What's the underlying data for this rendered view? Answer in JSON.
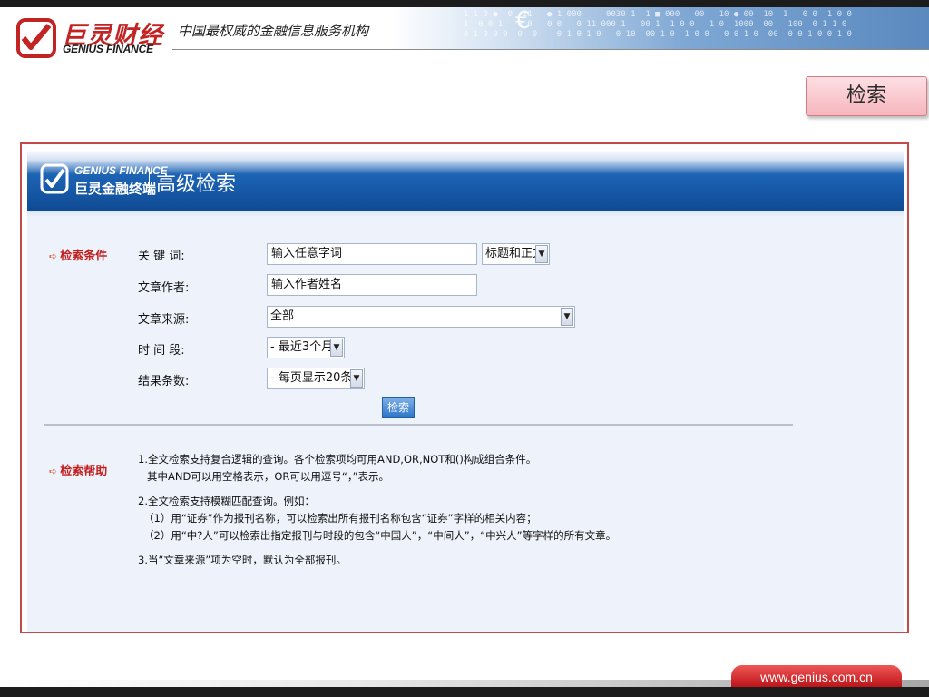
{
  "header": {
    "brand_cn": "巨灵财经",
    "brand_en": "GENIUS FINANCE",
    "slogan": "中国最权威的金融信息服务机构"
  },
  "top_search_button": "检索",
  "panel": {
    "brand_en": "GENIUS FINANCE",
    "brand_cn": "巨灵金融终端",
    "title": "高级检索"
  },
  "form": {
    "section_label": "检索条件",
    "keyword": {
      "label": "关 键 词:",
      "value": "输入任意字词",
      "scope": "标题和正文"
    },
    "author": {
      "label": "文章作者:",
      "value": "输入作者姓名"
    },
    "source": {
      "label": "文章来源:",
      "value": "全部"
    },
    "period": {
      "label": "时 间 段:",
      "value": "- 最近3个月 -"
    },
    "result_count": {
      "label": "结果条数:",
      "value": "- 每页显示20条 -"
    },
    "submit_label": "检索"
  },
  "help": {
    "section_label": "检索帮助",
    "lines": [
      "1.全文检索支持复合逻辑的查询。各个检索项均可用AND,OR,NOT和()构成组合条件。",
      "其中AND可以用空格表示，OR可以用逗号“，”表示。",
      "2.全文检索支持模糊匹配查询。例如：",
      "（1）用“证券”作为报刊名称，可以检索出所有报刊名称包含“证券”字样的相关内容；",
      "（2）用“中?人”可以检索出指定报刊与时段的包含“中国人”，“中间人”，“中兴人”等字样的所有文章。",
      "3.当“文章来源”项为空时，默认为全部报刊。"
    ]
  },
  "footer": {
    "url": "www.genius.com.cn"
  },
  "colors": {
    "brand_red": "#c22323",
    "panel_blue": "#1556a4",
    "background": "#eef3fb"
  }
}
